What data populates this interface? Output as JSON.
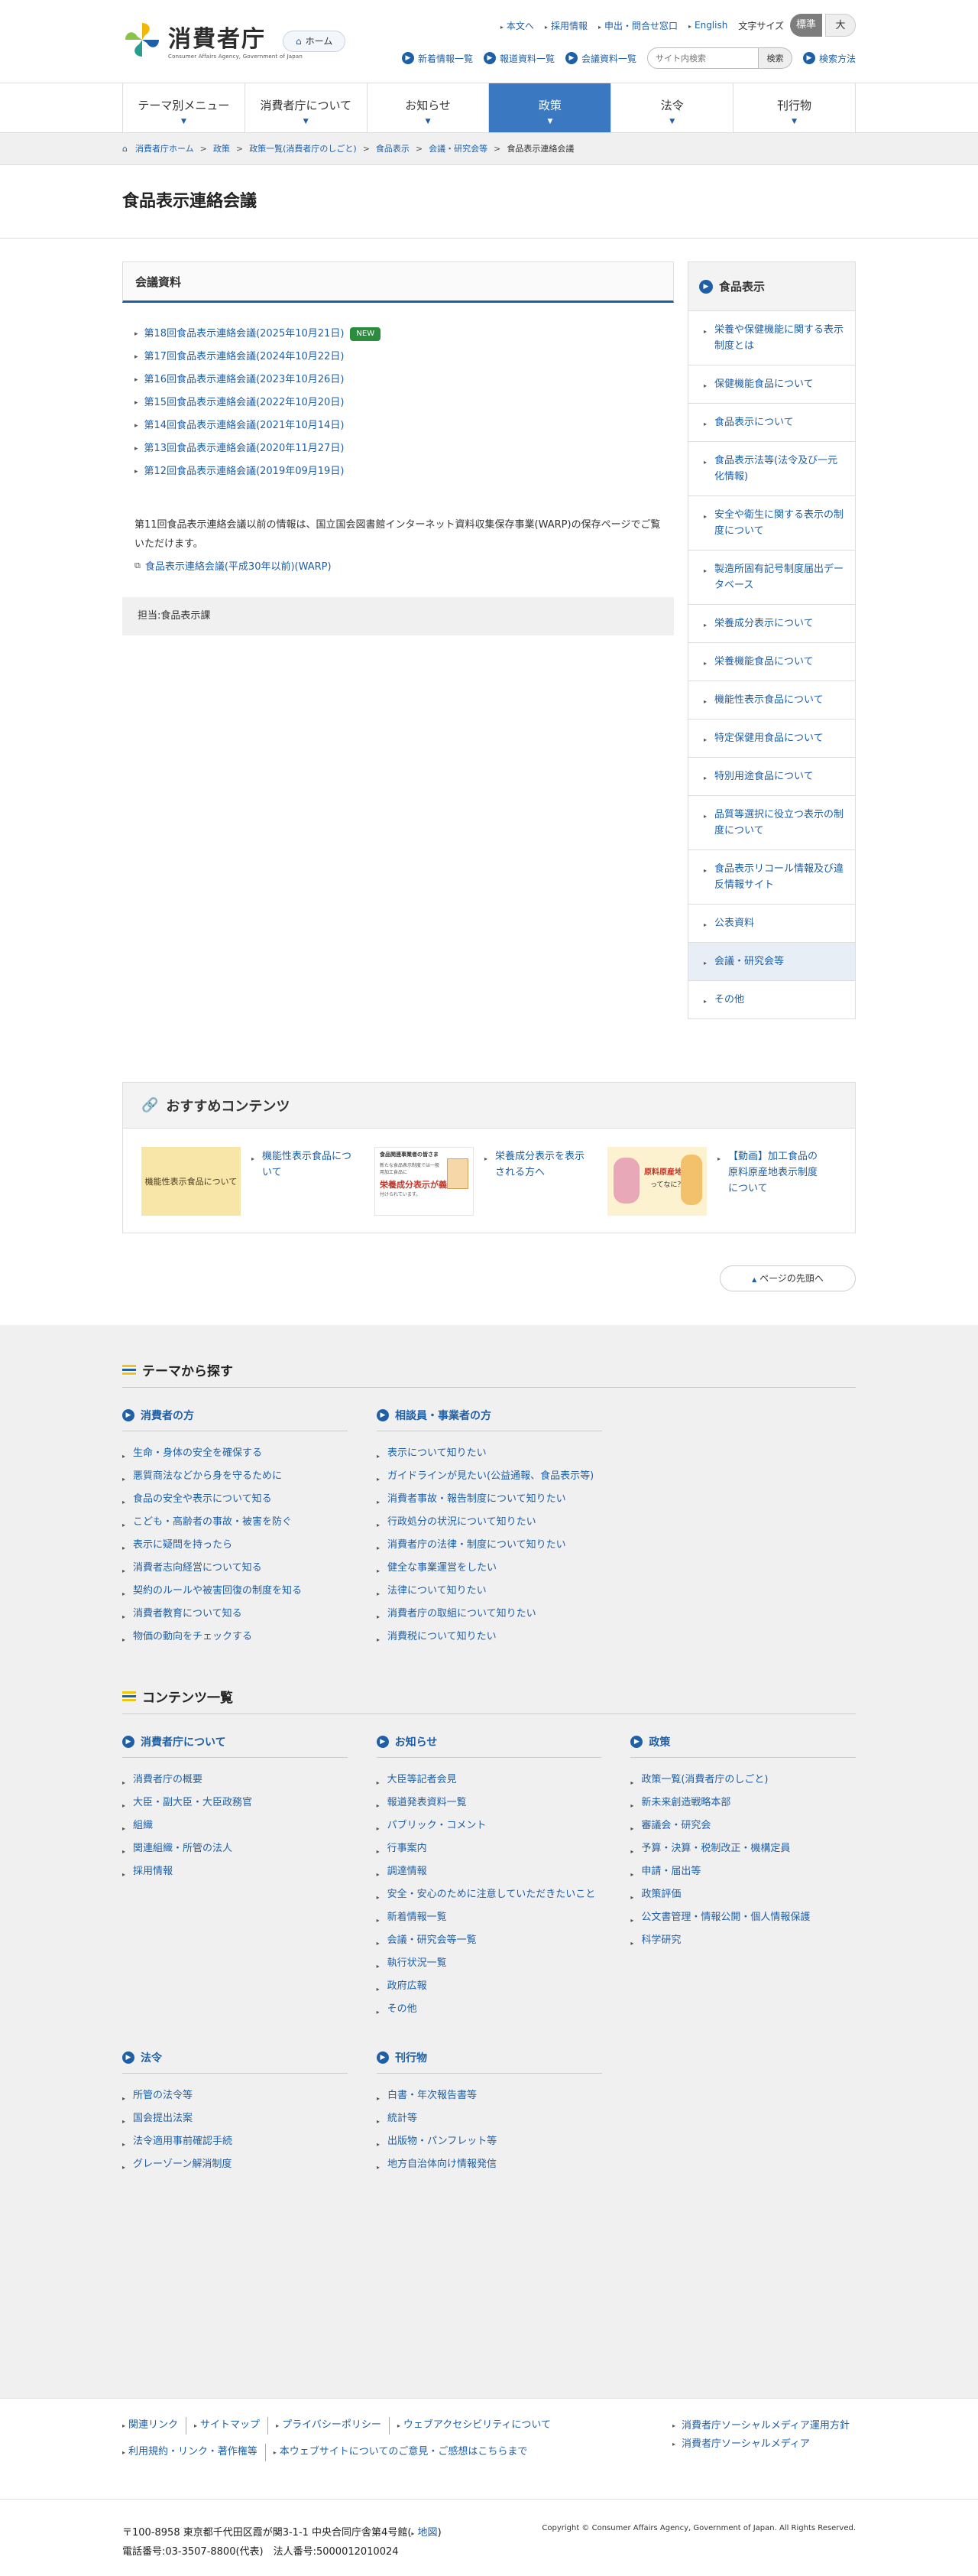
{
  "site": {
    "logo_jp": "消費者庁",
    "logo_en": "Consumer Affairs Agency, Government of Japan",
    "home_label": "ホーム"
  },
  "top_links": [
    "本文へ",
    "採用情報",
    "申出・問合せ窓口",
    "English"
  ],
  "font_size": {
    "label": "文字サイズ",
    "standard": "標準",
    "large": "大"
  },
  "sub_links": [
    "新着情報一覧",
    "報道資料一覧",
    "会議資料一覧"
  ],
  "search": {
    "placeholder": "サイト内検索",
    "button": "検索",
    "howto": "検索方法"
  },
  "gnav": [
    "テーマ別メニュー",
    "消費者庁について",
    "お知らせ",
    "政策",
    "法令",
    "刊行物"
  ],
  "breadcrumb": [
    "消費者庁ホーム",
    "政策",
    "政策一覧(消費者庁のしごと)",
    "食品表示",
    "会議・研究会等",
    "食品表示連絡会議"
  ],
  "page_title": "食品表示連絡会議",
  "content": {
    "box_title": "会議資料",
    "meetings": [
      "第18回食品表示連絡会議(2025年10月21日)",
      "第17回食品表示連絡会議(2024年10月22日)",
      "第16回食品表示連絡会議(2023年10月26日)",
      "第15回食品表示連絡会議(2022年10月20日)",
      "第14回食品表示連絡会議(2021年10月14日)",
      "第13回食品表示連絡会議(2020年11月27日)",
      "第12回食品表示連絡会議(2019年09月19日)"
    ],
    "new_badge": "NEW",
    "note": "第11回食品表示連絡会議以前の情報は、国立国会図書館インターネット資料収集保存事業(WARP)の保存ページでご覧いただけます。",
    "warp_link": "食品表示連絡会議(平成30年以前)(WARP)",
    "charge": "担当:食品表示課"
  },
  "sidebar": {
    "title": "食品表示",
    "items": [
      "栄養や保健機能に関する表示制度とは",
      "保健機能食品について",
      "食品表示について",
      "食品表示法等(法令及び一元化情報)",
      "安全や衛生に関する表示の制度について",
      "製造所固有記号制度届出データベース",
      "栄養成分表示について",
      "栄養機能食品について",
      "機能性表示食品について",
      "特定保健用食品について",
      "特別用途食品について",
      "品質等選択に役立つ表示の制度について",
      "食品表示リコール情報及び違反情報サイト",
      "公表資料",
      "会議・研究会等",
      "その他"
    ]
  },
  "recommended": {
    "title": "おすすめコンテンツ",
    "items": [
      {
        "thumb": "機能性表示食品について",
        "label": "機能性表示食品について"
      },
      {
        "thumb_title": "食品関連事業者の皆さま",
        "thumb_sub": "新たな食品表示制度では一般用加工食品に",
        "thumb_main": "栄養成分表示が義務",
        "thumb_tail": "付けられています。",
        "label": "栄養成分表示を表示される方へ"
      },
      {
        "thumb_main": "原料原産地表示",
        "thumb_tail": "ってなに？",
        "label": "【動画】加工食品の原料原産地表示制度について"
      }
    ]
  },
  "pagetop": "ページの先頭へ",
  "theme": {
    "title": "テーマから探す",
    "consumer": {
      "title": "消費者の方",
      "items": [
        "生命・身体の安全を確保する",
        "悪質商法などから身を守るために",
        "食品の安全や表示について知る",
        "こども・高齢者の事故・被害を防ぐ",
        "表示に疑問を持ったら",
        "消費者志向経営について知る",
        "契約のルールや被害回復の制度を知る",
        "消費者教育について知る",
        "物価の動向をチェックする"
      ]
    },
    "business": {
      "title": "相談員・事業者の方",
      "items": [
        "表示について知りたい",
        "ガイドラインが見たい(公益通報、食品表示等)",
        "消費者事故・報告制度について知りたい",
        "行政処分の状況について知りたい",
        "消費者庁の法律・制度について知りたい",
        "健全な事業運営をしたい",
        "法律について知りたい",
        "消費者庁の取組について知りたい",
        "消費税について知りたい"
      ]
    }
  },
  "contents_list": {
    "title": "コンテンツ一覧",
    "about": {
      "title": "消費者庁について",
      "items": [
        "消費者庁の概要",
        "大臣・副大臣・大臣政務官",
        "組織",
        "関連組織・所管の法人",
        "採用情報"
      ]
    },
    "news": {
      "title": "お知らせ",
      "items": [
        "大臣等記者会見",
        "報道発表資料一覧",
        "パブリック・コメント",
        "行事案内",
        "調達情報",
        "安全・安心のために注意していただきたいこと",
        "新着情報一覧",
        "会議・研究会等一覧",
        "執行状況一覧",
        "政府広報",
        "その他"
      ]
    },
    "policy": {
      "title": "政策",
      "items": [
        "政策一覧(消費者庁のしごと)",
        "新未来創造戦略本部",
        "審議会・研究会",
        "予算・決算・税制改正・機構定員",
        "申請・届出等",
        "政策評価",
        "公文書管理・情報公開・個人情報保護",
        "科学研究"
      ]
    },
    "law": {
      "title": "法令",
      "items": [
        "所管の法令等",
        "国会提出法案",
        "法令適用事前確認手続",
        "グレーゾーン解消制度"
      ]
    },
    "publications": {
      "title": "刊行物",
      "items": [
        "白書・年次報告書等",
        "統計等",
        "出版物・パンフレット等",
        "地方自治体向け情報発信"
      ]
    }
  },
  "bottom_links": {
    "row1": [
      "関連リンク",
      "サイトマップ",
      "プライバシーポリシー",
      "ウェブアクセシビリティについて"
    ],
    "row2": [
      "利用規約・リンク・著作権等",
      "本ウェブサイトについてのご意見・ご感想はこちらまで"
    ],
    "right": [
      "消費者庁ソーシャルメディア運用方針",
      "消費者庁ソーシャルメディア"
    ]
  },
  "address": {
    "line1": "〒100-8958 東京都千代田区霞が関3-1-1 中央合同庁舎第4号館(",
    "map": "地図",
    "line1_end": ")",
    "line2": "電話番号:03-3507-8800(代表)　法人番号:5000012010024",
    "copyright": "Copyright © Consumer Affairs Agency, Government of Japan. All Rights Reserved."
  }
}
